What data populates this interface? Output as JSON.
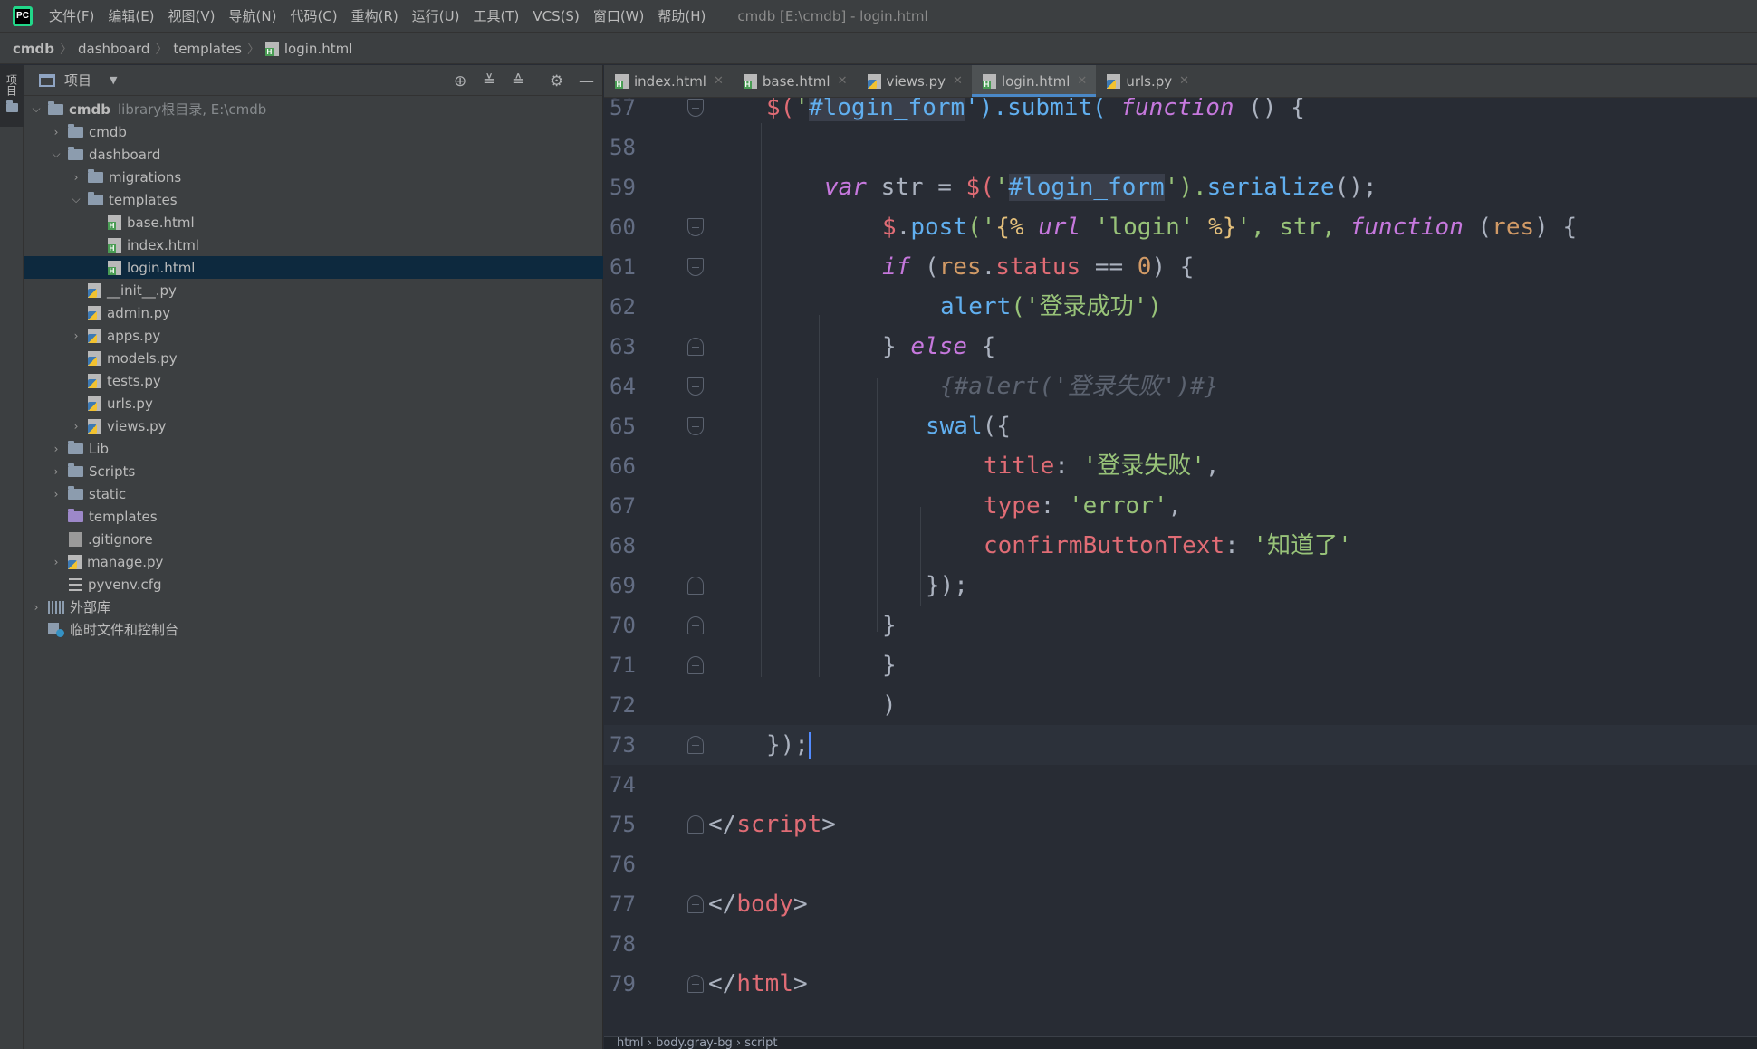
{
  "menubar": {
    "logo_text": "PC",
    "items": [
      "文件(F)",
      "编辑(E)",
      "视图(V)",
      "导航(N)",
      "代码(C)",
      "重构(R)",
      "运行(U)",
      "工具(T)",
      "VCS(S)",
      "窗口(W)",
      "帮助(H)"
    ],
    "window_title": "cmdb [E:\\cmdb] - login.html"
  },
  "breadcrumb": [
    "cmdb",
    "dashboard",
    "templates",
    "login.html"
  ],
  "side_stripe": {
    "project_label": "项目"
  },
  "project_panel": {
    "title": "项目",
    "root_hint": "library根目录, E:\\cmdb",
    "tree": [
      {
        "label": "cmdb",
        "icon": "folder",
        "expanded": true
      },
      {
        "label": "cmdb",
        "icon": "folder",
        "expanded": false
      },
      {
        "label": "dashboard",
        "icon": "folder",
        "expanded": true
      },
      {
        "label": "migrations",
        "icon": "folder",
        "expanded": false
      },
      {
        "label": "templates",
        "icon": "folder",
        "expanded": true
      },
      {
        "label": "base.html",
        "icon": "html"
      },
      {
        "label": "index.html",
        "icon": "html"
      },
      {
        "label": "login.html",
        "icon": "html",
        "selected": true
      },
      {
        "label": "__init__.py",
        "icon": "python"
      },
      {
        "label": "admin.py",
        "icon": "python"
      },
      {
        "label": "apps.py",
        "icon": "python",
        "expanded": false
      },
      {
        "label": "models.py",
        "icon": "python"
      },
      {
        "label": "tests.py",
        "icon": "python"
      },
      {
        "label": "urls.py",
        "icon": "python"
      },
      {
        "label": "views.py",
        "icon": "python",
        "expanded": false
      },
      {
        "label": "Lib",
        "icon": "folder",
        "expanded": false
      },
      {
        "label": "Scripts",
        "icon": "folder",
        "expanded": false
      },
      {
        "label": "static",
        "icon": "folder",
        "expanded": false
      },
      {
        "label": "templates",
        "icon": "folder-purple"
      },
      {
        "label": ".gitignore",
        "icon": "git"
      },
      {
        "label": "manage.py",
        "icon": "python",
        "expanded": false
      },
      {
        "label": "pyvenv.cfg",
        "icon": "config"
      },
      {
        "label": "外部库",
        "icon": "library",
        "expanded": false
      },
      {
        "label": "临时文件和控制台",
        "icon": "scratch"
      }
    ]
  },
  "tabs": [
    {
      "label": "index.html",
      "icon": "html",
      "active": false
    },
    {
      "label": "base.html",
      "icon": "html",
      "active": false
    },
    {
      "label": "views.py",
      "icon": "python",
      "active": false
    },
    {
      "label": "login.html",
      "icon": "html",
      "active": true
    },
    {
      "label": "urls.py",
      "icon": "python",
      "active": false
    }
  ],
  "editor": {
    "partial_top_line": "56",
    "line_numbers": [
      "57",
      "58",
      "59",
      "60",
      "61",
      "62",
      "63",
      "64",
      "65",
      "66",
      "67",
      "68",
      "69",
      "70",
      "71",
      "72",
      "73",
      "74",
      "75",
      "76",
      "77",
      "78",
      "79"
    ],
    "current_line": "73",
    "code": {
      "l57": [
        "$(",
        "'",
        "#login_form",
        "').submit( ",
        "function",
        " () {"
      ],
      "l59": [
        "var",
        " str = ",
        "$(",
        "'",
        "#login_form",
        "').",
        "serialize",
        "();"
      ],
      "l60": [
        "$",
        ".",
        "post",
        "('",
        "{%",
        " url ",
        "'login'",
        " %}",
        "', str, ",
        "function",
        " (",
        "res",
        ") {"
      ],
      "l61": [
        "if",
        " (",
        "res",
        ".",
        "status",
        " == ",
        "0",
        ") {"
      ],
      "l62": [
        "alert",
        "('",
        "登录成功",
        "')"
      ],
      "l63": [
        "} ",
        "else",
        " {"
      ],
      "l64": "{#alert('登录失败')#}",
      "l65": [
        "swal",
        "({"
      ],
      "l66": [
        "title",
        ": ",
        "'登录失败'",
        ","
      ],
      "l67": [
        "type",
        ": ",
        "'error'",
        ","
      ],
      "l68": [
        "confirmButtonText",
        ": ",
        "'知道了'"
      ],
      "l69": "});",
      "l70": "}",
      "l71": "}",
      "l72": ")",
      "l73": "});",
      "l75": [
        "</",
        "script",
        ">"
      ],
      "l77": [
        "</",
        "body",
        ">"
      ],
      "l79": [
        "</",
        "html",
        ">"
      ]
    }
  },
  "editor_breadcrumb": "html › body.gray-bg › script",
  "colors": {
    "keyword": "#c678dd",
    "function": "#61afef",
    "string": "#98c379",
    "variable": "#e06c75",
    "number": "#d19a66",
    "comment": "#5c6370",
    "selection": "#0d293e",
    "active_tab_underline": "#4a88c7"
  }
}
